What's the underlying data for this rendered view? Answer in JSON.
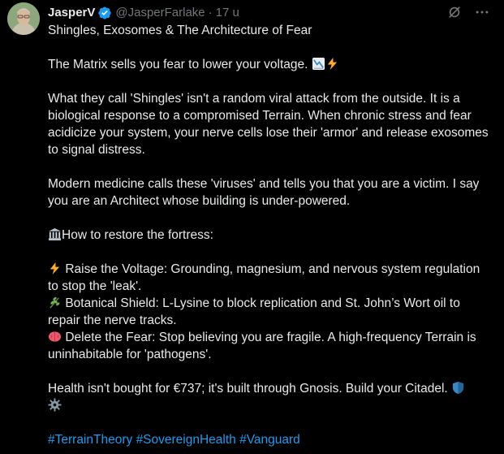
{
  "author": {
    "display_name": "JasperV",
    "handle": "@JasperFarlake",
    "separator": "·",
    "time": "17 u"
  },
  "tweet": {
    "title": "Shingles, Exosomes & The Architecture of Fear",
    "line_matrix": "The Matrix sells you fear to lower your voltage.",
    "para_shingles": "What they call 'Shingles' isn't a random viral attack from the outside. It is a biological response to a compromised Terrain. When chronic stress and fear acidicize your system, your nerve cells lose their 'armor' and release exosomes to signal distress.",
    "para_medicine": "Modern medicine calls these 'viruses' and tells you that you are a victim. I say you are an Architect whose building is under-powered.",
    "heading_restore": "How to restore the fortress:",
    "item_voltage": "Raise the Voltage: Grounding, magnesium, and nervous system regulation to stop the 'leak'.",
    "item_botanical": "Botanical Shield: L-Lysine to block replication and St. John’s Wort oil to repair the nerve tracks.",
    "item_fear": "Delete the Fear: Stop believing you are fragile. A high-frequency Terrain is uninhabitable for 'pathogens'.",
    "closing": "Health isn't bought for €737; it's built through Gnosis. Build your Citadel.",
    "hashtags": [
      "#TerrainTheory",
      "#SovereignHealth",
      "#Vanguard"
    ]
  },
  "icons": {
    "verified": "verified-badge-icon",
    "grok": "grok-icon",
    "more": "more-options-icon",
    "chart": "chart-decreasing-emoji",
    "bolt": "high-voltage-emoji",
    "building": "classical-building-emoji",
    "herb": "herb-emoji",
    "brain": "brain-emoji",
    "shield": "shield-emoji",
    "gear": "gear-emoji"
  },
  "colors": {
    "background": "#000000",
    "text": "#e7e9ea",
    "muted": "#71767b",
    "link": "#1d9bf0"
  }
}
